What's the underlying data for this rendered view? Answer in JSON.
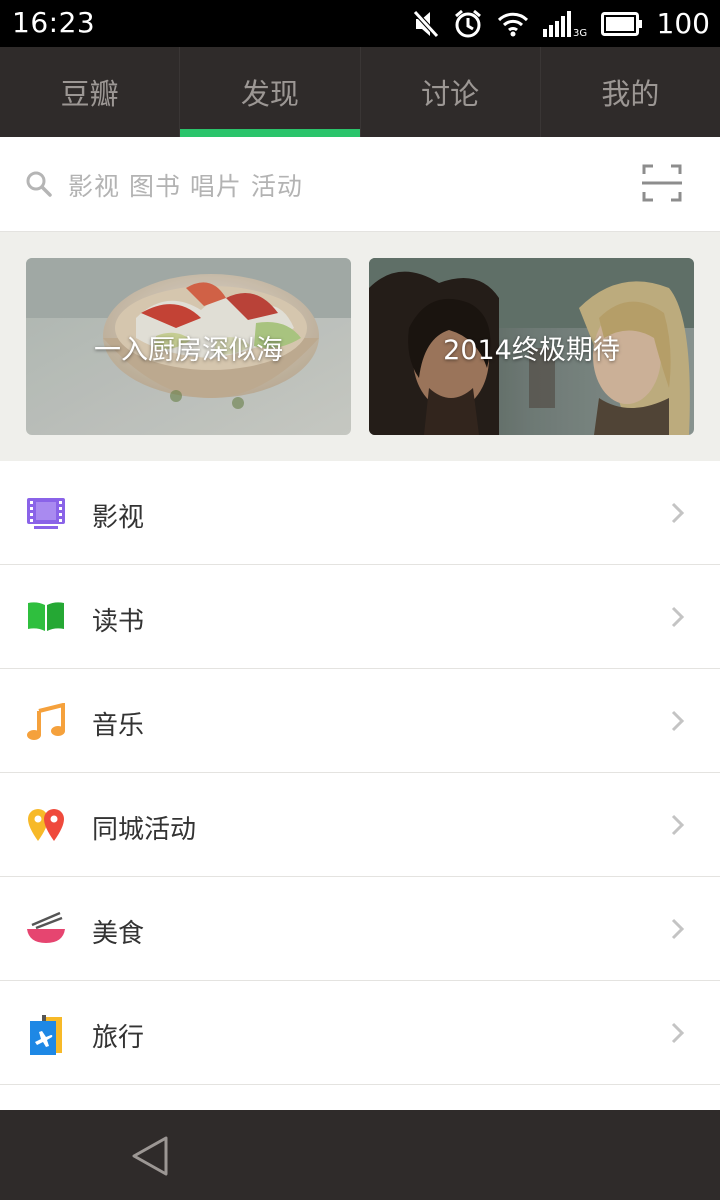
{
  "status_bar": {
    "time": "16:23",
    "battery": "100",
    "network": "3G",
    "icons": [
      "mute-icon",
      "alarm-icon",
      "wifi-icon",
      "signal-icon",
      "battery-icon"
    ]
  },
  "tabs": [
    {
      "label": "豆瓣",
      "active": false
    },
    {
      "label": "发现",
      "active": true
    },
    {
      "label": "讨论",
      "active": false
    },
    {
      "label": "我的",
      "active": false
    }
  ],
  "search": {
    "placeholder": "影视 图书 唱片 活动"
  },
  "banners": [
    {
      "title": "一入厨房深似海"
    },
    {
      "title": "2014终极期待"
    }
  ],
  "categories": [
    {
      "label": "影视",
      "icon": "film-icon",
      "color": "#8a63e8"
    },
    {
      "label": "读书",
      "icon": "book-icon",
      "color": "#2fbf3e"
    },
    {
      "label": "音乐",
      "icon": "music-note-icon",
      "color": "#f5a13c"
    },
    {
      "label": "同城活动",
      "icon": "map-pin-icon",
      "color": "#ef4a3c"
    },
    {
      "label": "美食",
      "icon": "bowl-chopsticks-icon",
      "color": "#e64570"
    },
    {
      "label": "旅行",
      "icon": "luggage-plane-icon",
      "color": "#1e88e5"
    }
  ],
  "colors": {
    "accent": "#2bc46b",
    "tab_bar": "#2f2b2a",
    "tab_text": "#9c9794"
  }
}
